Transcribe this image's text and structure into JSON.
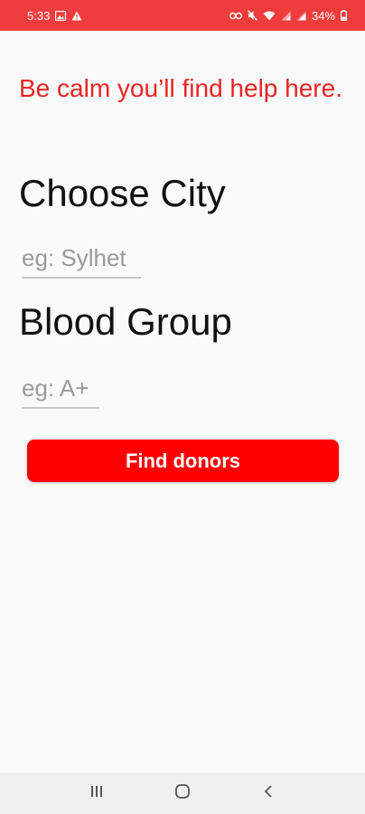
{
  "status_bar": {
    "time": "5:33",
    "battery": "34%",
    "background_color": "#f03c3c",
    "left_icons": [
      "image-icon",
      "warning-icon"
    ],
    "right_icons": [
      "link-icon",
      "mute-icon",
      "wifi-icon",
      "signal-icon",
      "signal-icon",
      "battery-icon"
    ]
  },
  "page": {
    "tagline": "Be calm you’ll find help here.",
    "accent_color": "#e82424"
  },
  "city": {
    "title": "Choose City",
    "placeholder": "eg: Sylhet",
    "value": ""
  },
  "blood_group": {
    "title": "Blood Group",
    "placeholder": "eg: A+",
    "value": ""
  },
  "actions": {
    "find_label": "Find donors",
    "button_color": "#ff0000"
  },
  "nav_bar": {
    "buttons": [
      "recent-apps-icon",
      "home-icon",
      "back-icon"
    ]
  }
}
